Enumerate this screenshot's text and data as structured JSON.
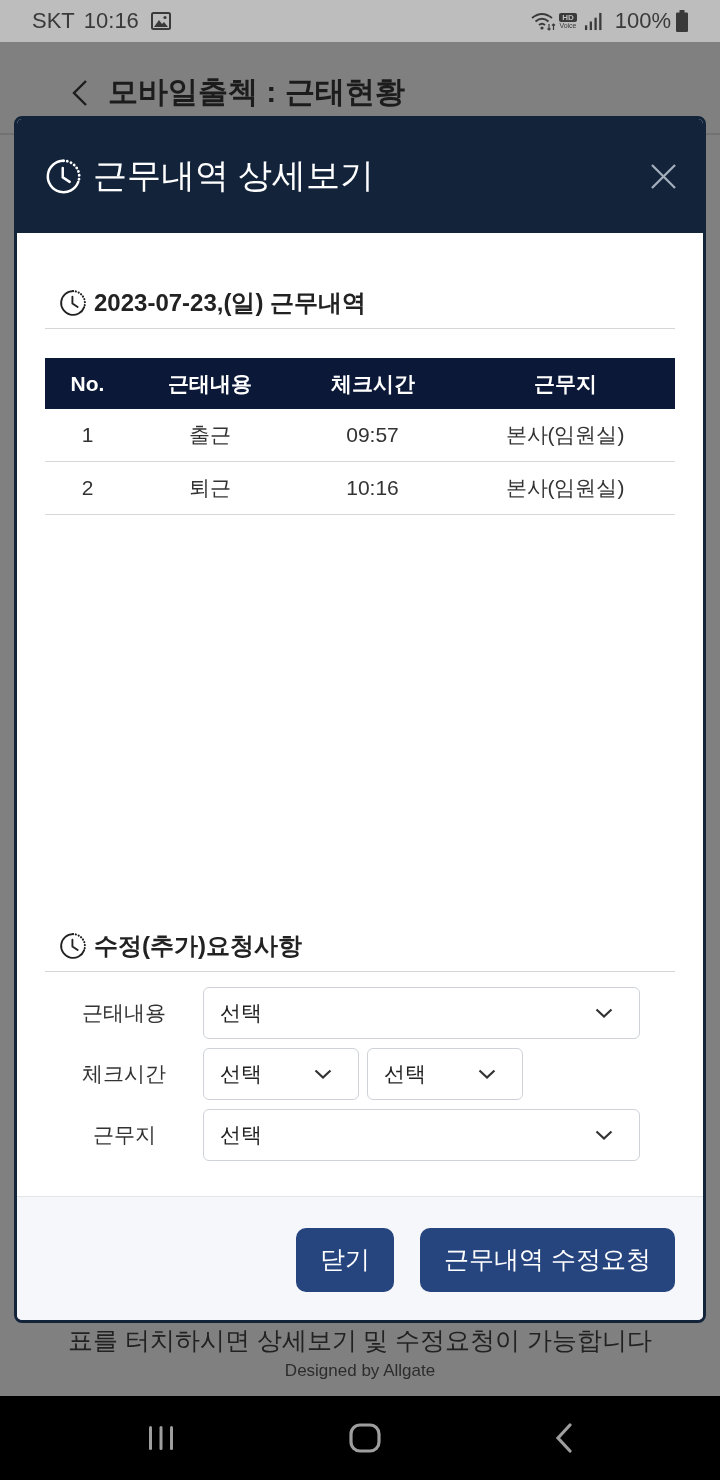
{
  "status_bar": {
    "carrier": "SKT",
    "time": "10:16",
    "hd_badge": "HD",
    "voice_label": "Voice",
    "battery": "100%"
  },
  "page": {
    "title": "모바일출첵 : 근태현황",
    "hint": "표를 터치하시면 상세보기 및 수정요청이 가능합니다",
    "credit": "Designed by Allgate"
  },
  "dialog": {
    "title": "근무내역 상세보기",
    "history": {
      "heading": "2023-07-23,(일) 근무내역",
      "columns": [
        "No.",
        "근태내용",
        "체크시간",
        "근무지"
      ],
      "rows": [
        [
          "1",
          "출근",
          "09:57",
          "본사(임원실)"
        ],
        [
          "2",
          "퇴근",
          "10:16",
          "본사(임원실)"
        ]
      ]
    },
    "request": {
      "heading": "수정(추가)요청사항",
      "fields": [
        {
          "label": "근태내용",
          "selects": [
            {
              "value": "선택"
            }
          ]
        },
        {
          "label": "체크시간",
          "selects": [
            {
              "value": "선택"
            },
            {
              "value": "선택"
            }
          ]
        },
        {
          "label": "근무지",
          "selects": [
            {
              "value": "선택"
            }
          ]
        }
      ]
    },
    "buttons": [
      {
        "label": "닫기"
      },
      {
        "label": "근무내역 수정요청"
      }
    ]
  }
}
